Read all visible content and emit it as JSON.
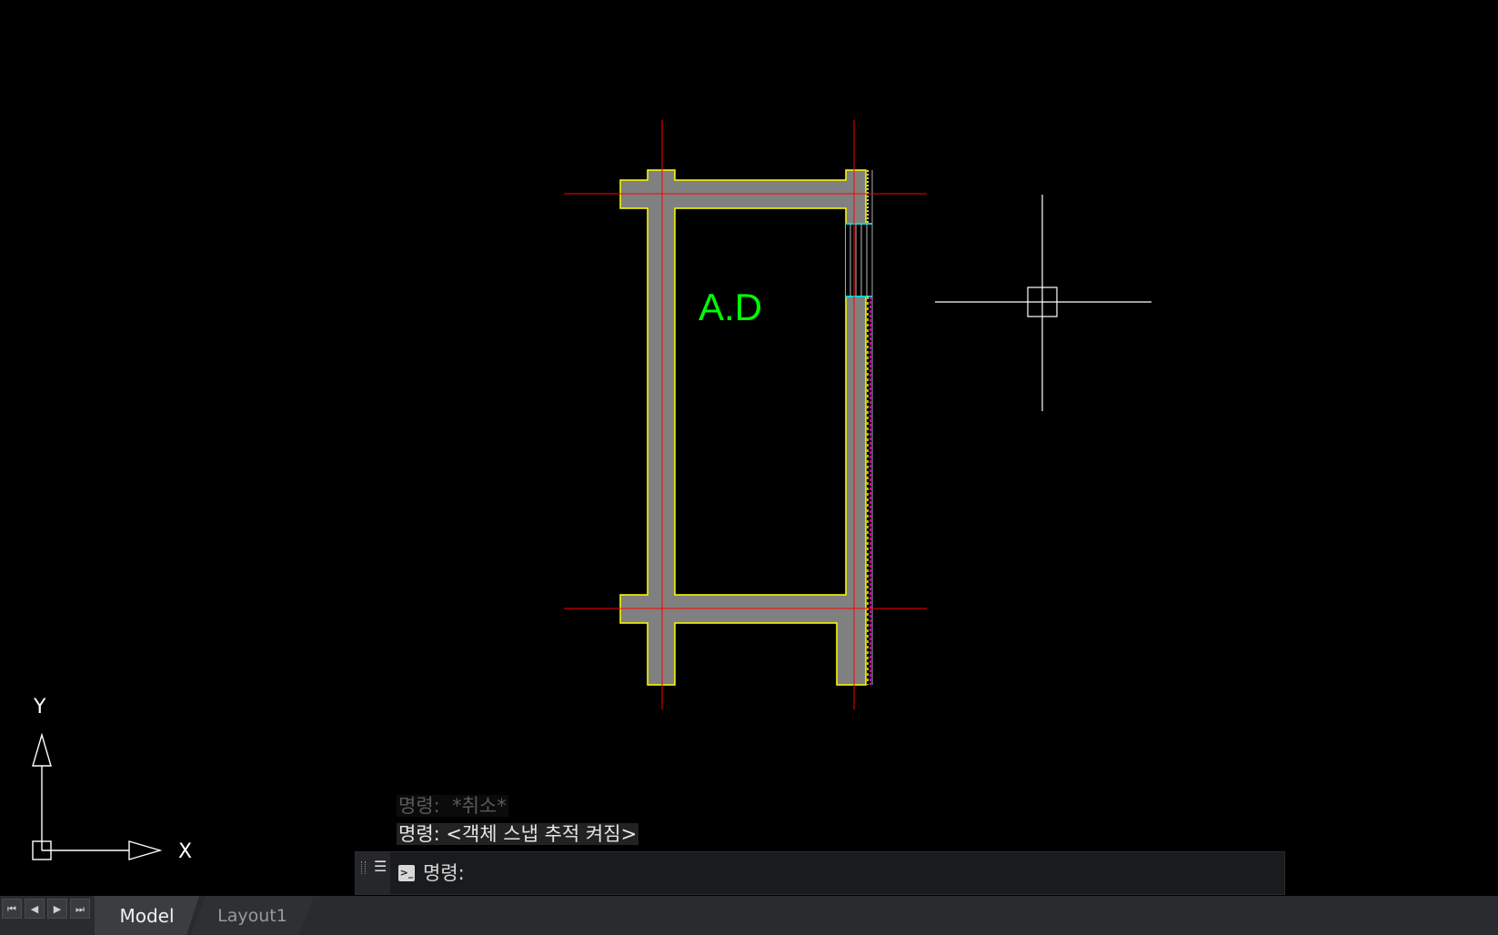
{
  "drawing": {
    "room_label": "A.D",
    "ucs_x_label": "X",
    "ucs_y_label": "Y"
  },
  "command_history": {
    "line1": "명령:  *취소*",
    "line2": "명령: <객체 스냅 추적 켜짐>"
  },
  "command_line": {
    "placeholder": "명령:",
    "menu_icon": "menu-icon",
    "prompt_icon": "prompt-icon"
  },
  "layout_tabs": {
    "nav_buttons": [
      "first",
      "previous",
      "next",
      "last"
    ],
    "tabs": [
      {
        "label": "Model",
        "active": true
      },
      {
        "label": "Layout1",
        "active": false
      }
    ]
  },
  "colors": {
    "background": "#000000",
    "wall_fill": "#808080",
    "wall_outline": "#ffff00",
    "grid_axis": "#ff0000",
    "text": "#00ff00",
    "cursor": "#ffffff",
    "window": "#00d5d5",
    "hatch": "#ff00ff"
  }
}
